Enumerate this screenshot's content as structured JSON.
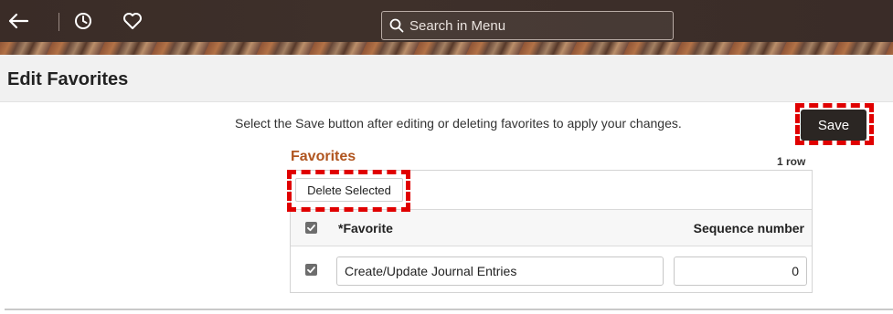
{
  "header": {
    "back_icon": "arrow-left-icon",
    "recent_icon": "clock-icon",
    "favorites_icon": "heart-icon",
    "search": {
      "placeholder": "Search in Menu",
      "value": ""
    }
  },
  "page": {
    "title": "Edit Favorites"
  },
  "content": {
    "instruction": "Select the Save button after editing or deleting favorites to apply your changes.",
    "save_label": "Save"
  },
  "grid": {
    "title": "Favorites",
    "row_count": "1 row",
    "delete_label": "Delete Selected",
    "columns": {
      "favorite": "*Favorite",
      "sequence": "Sequence number"
    },
    "header_checked": true,
    "rows": [
      {
        "checked": true,
        "favorite": "Create/Update Journal Entries",
        "sequence": "0"
      }
    ]
  },
  "colors": {
    "accent": "#b0551f",
    "highlight": "#e00000",
    "banner": "#3b2d28",
    "button": "#2b2623"
  }
}
